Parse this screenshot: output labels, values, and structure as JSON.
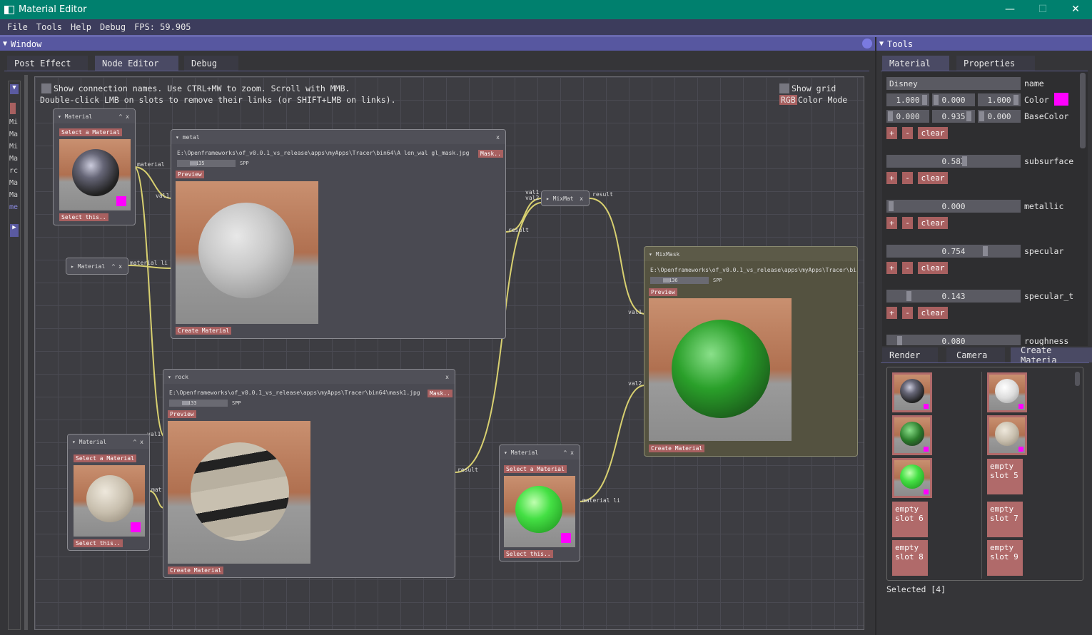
{
  "window": {
    "title": "Material Editor",
    "min": "—",
    "max": "☐",
    "close": "✕"
  },
  "menu": {
    "file": "File",
    "tools": "Tools",
    "help": "Help",
    "debug": "Debug",
    "fps": "FPS: 59.905"
  },
  "left_panel": {
    "title": "Window",
    "tabs": [
      "Post Effect",
      "Node Editor",
      "Debug"
    ]
  },
  "left_list": [
    "Mi",
    "Ma",
    "Mi",
    "Ma",
    "rc",
    "Ma",
    "Ma",
    "Ma",
    "me"
  ],
  "canvas": {
    "show_names": "Show connection names.  Use CTRL+MW to zoom. Scroll with MMB.",
    "hint2": "Double-click LMB on slots to remove their links (or SHIFT+LMB on links).",
    "show_grid": "Show grid",
    "rgb": "RGB",
    "color_mode": "Color Mode"
  },
  "nodes": {
    "mat1": {
      "title": "▾ Material",
      "ctrl": "^ x",
      "select": "Select a Material",
      "select_this": "Select this..",
      "port": "material"
    },
    "mat2": {
      "title": "▸ Material",
      "ctrl": "^ x",
      "port": "material li"
    },
    "metal": {
      "title": "▾ metal",
      "x": "x",
      "path": "E:\\Openframeworks\\of_v0.0.1_vs_release\\apps\\myApps\\Tracer\\bin64\\A len_wal gl_mask.jpg",
      "mask": "Mask..",
      "spp": "135",
      "spp_label": "SPP",
      "preview": "Preview",
      "create": "Create Material",
      "port_in": "val1",
      "port_out": "result"
    },
    "mixmat": {
      "title": "▸ MixMat",
      "x": "x",
      "port_in1": "val1",
      "port_in2": "val2",
      "port_out": "result"
    },
    "mixmask": {
      "title": "▾ MixMask",
      "path": "E:\\Openframeworks\\of_v0.0.1_vs_release\\apps\\myApps\\Tracer\\bi",
      "spp": "136",
      "spp_label": "SPP",
      "preview": "Preview",
      "create": "Create Material",
      "port_in1": "val1",
      "port_in2": "val2"
    },
    "rock": {
      "title": "▾ rock",
      "x": "x",
      "path": "E:\\Openframeworks\\of_v0.0.1_vs_release\\apps\\myApps\\Tracer\\bin64\\mask1.jpg",
      "mask": "Mask..",
      "spp": "133",
      "spp_label": "SPP",
      "preview": "Preview",
      "create": "Create Material",
      "port_in": "val1",
      "port_out": "result"
    },
    "mat3": {
      "title": "▾ Material",
      "ctrl": "^ x",
      "select": "Select a Material",
      "select_this": "Select this..",
      "port": "mat"
    },
    "mat4": {
      "title": "▾ Material",
      "ctrl": "^ x",
      "select": "Select a Material",
      "select_this": "Select this..",
      "port": "material li"
    }
  },
  "tools": {
    "title": "Tools",
    "tabs": [
      "Material",
      "Properties"
    ],
    "name_value": "Disney",
    "name_label": "name",
    "color": [
      "1.000",
      "0.000",
      "1.000"
    ],
    "color_label": "Color",
    "basecolor": [
      "0.000",
      "0.935",
      "0.000"
    ],
    "basecolor_label": "BaseColor",
    "plus": "+",
    "minus": "-",
    "clear": "clear",
    "subsurface": "0.583",
    "subsurface_label": "subsurface",
    "metallic": "0.000",
    "metallic_label": "metallic",
    "specular": "0.754",
    "specular_label": "specular",
    "specular_t": "0.143",
    "specular_t_label": "specular_t",
    "roughness": "0.080",
    "roughness_label": "roughness",
    "bottom_tabs": [
      "Render",
      "Camera",
      "Create Materia"
    ],
    "slots": {
      "s5": "empty slot 5",
      "s6": "empty slot 6",
      "s7": "empty slot 7",
      "s8": "empty slot 8",
      "s9": "empty slot 9"
    },
    "selected": "Selected [4]",
    "accent": "#ff00ff"
  }
}
